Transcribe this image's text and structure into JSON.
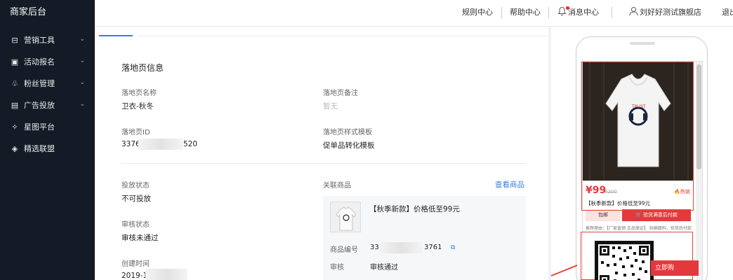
{
  "sidebar": {
    "brand": "商家后台",
    "items": [
      {
        "label": "营销工具",
        "icon": "shop-icon",
        "glyph": "⊟",
        "has_children": true
      },
      {
        "label": "活动报名",
        "icon": "form-icon",
        "glyph": "▣",
        "has_children": true
      },
      {
        "label": "粉丝管理",
        "icon": "fans-icon",
        "glyph": "♧",
        "has_children": true
      },
      {
        "label": "广告投放",
        "icon": "ad-icon",
        "glyph": "▤",
        "has_children": true
      },
      {
        "label": "星图平台",
        "icon": "star-icon",
        "glyph": "✧",
        "has_children": false
      },
      {
        "label": "精选联盟",
        "icon": "diamond-icon",
        "glyph": "◈",
        "has_children": false
      }
    ]
  },
  "topbar": {
    "rules": "规则中心",
    "help": "帮助中心",
    "messages": "消息中心",
    "store": "刘好好测试旗舰店",
    "logout": "退出"
  },
  "main": {
    "section_title": "落地页信息",
    "fields": {
      "name_label": "落地页名称",
      "name_value": "卫衣-秋冬",
      "remark_label": "落地页备注",
      "remark_value": "暂无",
      "id_label": "落地页ID",
      "id_prefix": "3376",
      "id_suffix": "520",
      "template_label": "落地页样式模板",
      "template_value": "促单品转化模板",
      "status_label": "投放状态",
      "status_value": "不可投放",
      "review_label": "审核状态",
      "review_value": "审核未通过",
      "created_label": "创建时间",
      "created_prefix": "2019-1",
      "related_label": "关联商品",
      "view_product_link": "查看商品"
    },
    "product": {
      "name": "【秋季新款】价格低至99元",
      "id_label": "商品编号",
      "id_prefix": "33",
      "id_suffix": "3761",
      "review_label": "审核",
      "review_value": "审核通过"
    }
  },
  "preview": {
    "price": "¥99",
    "old_price": "¥200",
    "hot": "热销",
    "title": "【秋季新款】价格低至99元",
    "free_shipping": "包邮",
    "buy_button": "验货满意后付款",
    "note": "推荐理由：【厂家直销 正品保证】 纯棉面料，验货后付款",
    "claim_button": "立即购",
    "accent": "#e4393c"
  }
}
